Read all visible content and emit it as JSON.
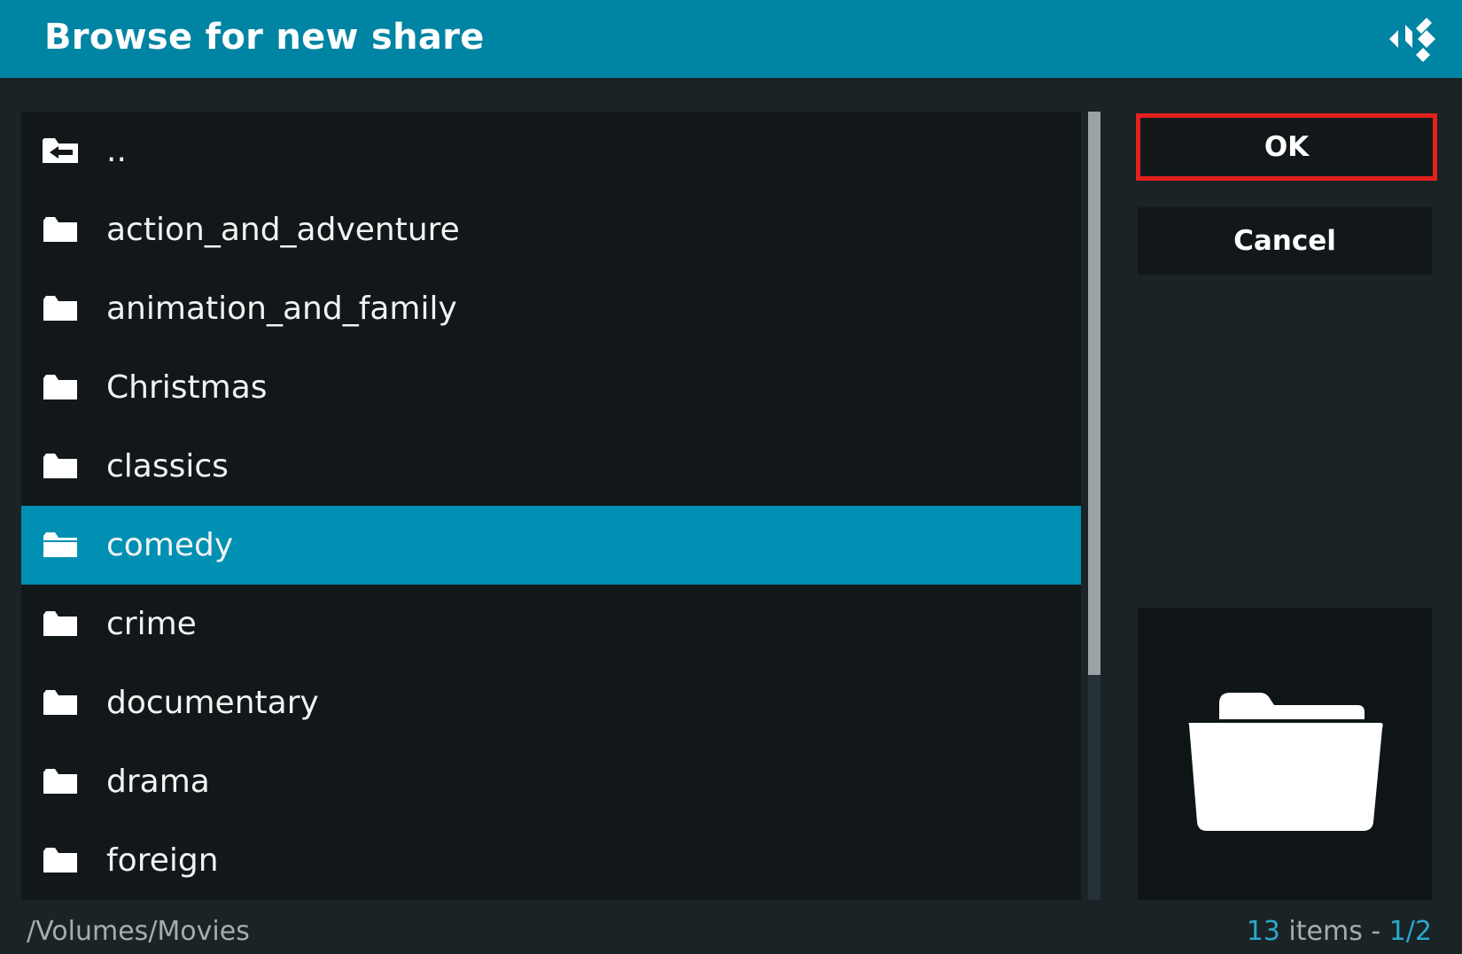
{
  "header": {
    "title": "Browse for new share",
    "logo_icon": "kodi-logo-icon"
  },
  "list": {
    "selected_index": 5,
    "items": [
      {
        "label": "..",
        "icon": "folder-back-icon"
      },
      {
        "label": "action_and_adventure",
        "icon": "folder-icon"
      },
      {
        "label": "animation_and_family",
        "icon": "folder-icon"
      },
      {
        "label": "Christmas",
        "icon": "folder-icon"
      },
      {
        "label": "classics",
        "icon": "folder-icon"
      },
      {
        "label": "comedy",
        "icon": "folder-icon"
      },
      {
        "label": "crime",
        "icon": "folder-icon"
      },
      {
        "label": "documentary",
        "icon": "folder-icon"
      },
      {
        "label": "drama",
        "icon": "folder-icon"
      },
      {
        "label": "foreign",
        "icon": "folder-icon"
      }
    ]
  },
  "buttons": {
    "ok_label": "OK",
    "cancel_label": "Cancel"
  },
  "footer": {
    "path": "/Volumes/Movies",
    "count_number": "13",
    "count_word": " items - ",
    "page": "1/2"
  },
  "colors": {
    "header": "#0084a3",
    "selected_row": "#0090b3",
    "focus_border": "#e4201c",
    "accent_text": "#2aa8cc"
  }
}
